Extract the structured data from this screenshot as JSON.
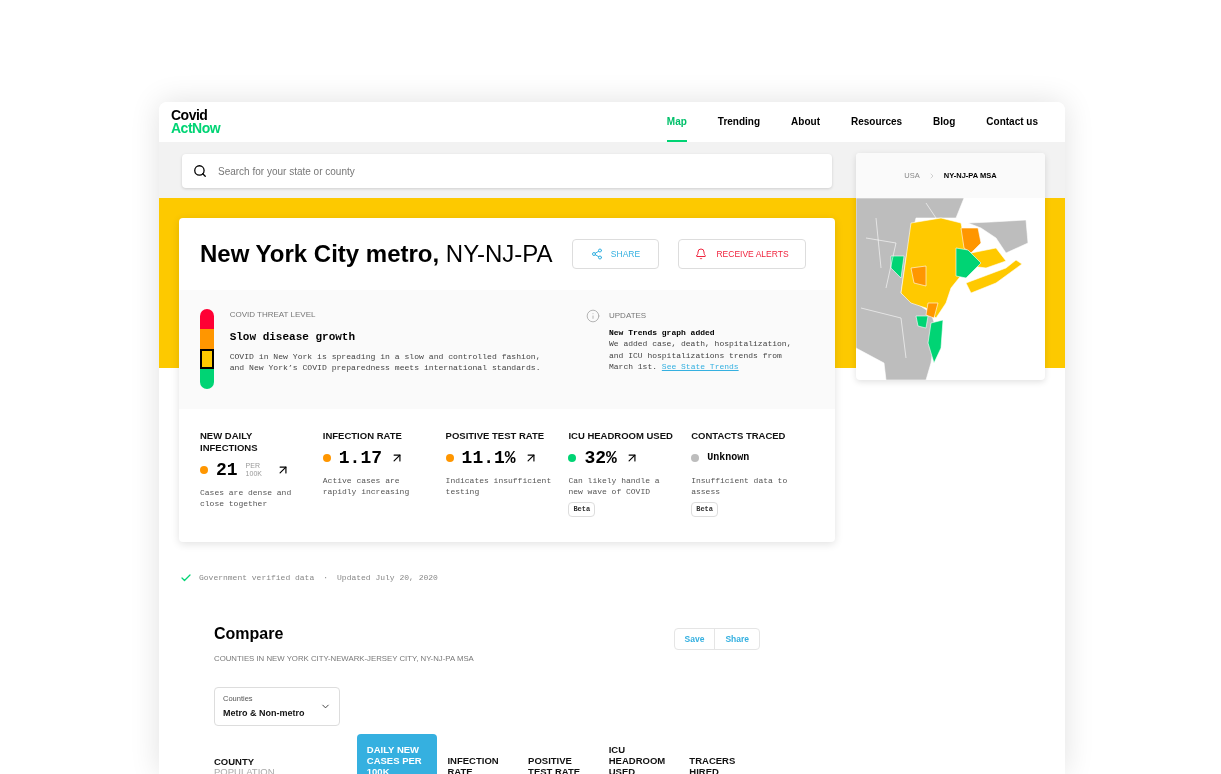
{
  "logo": {
    "line_1": "Covid",
    "line_2": "ActNow"
  },
  "nav": [
    {
      "label": "Map",
      "selected": true
    },
    {
      "label": "Trending",
      "selected": false
    },
    {
      "label": "About",
      "selected": false
    },
    {
      "label": "Resources",
      "selected": false
    },
    {
      "label": "Blog",
      "selected": false
    },
    {
      "label": "Contact us",
      "selected": false
    }
  ],
  "search": {
    "placeholder": "Search for your state or county"
  },
  "location": {
    "title": "**New York City metro,** NY-NJ-PA",
    "share_button": "SHARE",
    "alerts_button": "RECEIVE ALERTS"
  },
  "threat": {
    "heading": "COVID THREAT LEVEL",
    "level_name": "Slow disease growth",
    "description": "COVID in New York is spreading in a slow and controlled fashion, and New York’s COVID preparedness meets international standards.",
    "levels": [
      {
        "color": "#ff0034",
        "selected": false
      },
      {
        "color": "#ff9600",
        "selected": false
      },
      {
        "color": "#ffc900",
        "selected": true
      },
      {
        "color": "#00d474",
        "selected": false
      }
    ]
  },
  "updates": {
    "heading": "UPDATES",
    "title": "New Trends graph added",
    "body": "We added case, death, hospitalization, and ICU hospitalizations trends from March 1st.",
    "link": "See State Trends"
  },
  "metrics": [
    {
      "label": "NEW DAILY INFECTIONS",
      "color": "#ff9600",
      "kind": "number",
      "value": "21",
      "unit": "PER 100K",
      "rising": true,
      "description": "Cases are dense and close together"
    },
    {
      "label": "INFECTION RATE",
      "color": "#ff9600",
      "kind": "number",
      "value": "1.17",
      "rising": true,
      "description": "Active cases are rapidly increasing"
    },
    {
      "label": "POSITIVE TEST RATE",
      "color": "#ff9600",
      "kind": "number",
      "value": "11.1%",
      "rising": true,
      "description": "Indicates insufficient testing"
    },
    {
      "label": "ICU HEADROOM USED",
      "color": "#00d474",
      "kind": "number",
      "value": "32%",
      "rising": true,
      "description": "Can likely handle a new wave of COVID",
      "badge": "Beta"
    },
    {
      "label": "CONTACTS TRACED",
      "color": "#bdbdbd",
      "kind": "text",
      "value": "Unknown",
      "description": "Insufficient data to assess",
      "badge": "Beta"
    }
  ],
  "footnote": {
    "verified": "Government verified data",
    "separator": "·",
    "updated": "Updated July 20, 2020"
  },
  "map": {
    "breadcrumb": [
      "USA",
      "NY-NJ-PA MSA"
    ]
  },
  "compare": {
    "title": "Compare",
    "subtitle": "COUNTIES IN NEW YORK CITY-NEWARK-JERSEY CITY, NY-NJ-PA MSA",
    "buttons": [
      "Save",
      "Share"
    ],
    "dropdown": {
      "label": "Counties",
      "value": "Metro & Non-metro"
    },
    "columns": [
      {
        "label": "COUNTY",
        "sublabel": "POPULATION",
        "selected": false
      },
      {
        "label": "DAILY NEW CASES PER 100K",
        "selected": true
      },
      {
        "label": "INFECTION RATE",
        "selected": false
      },
      {
        "label": "POSITIVE TEST RATE",
        "selected": false
      },
      {
        "label": "ICU HEADROOM USED",
        "selected": false
      },
      {
        "label": "TRACERS HIRED",
        "selected": false
      }
    ]
  }
}
